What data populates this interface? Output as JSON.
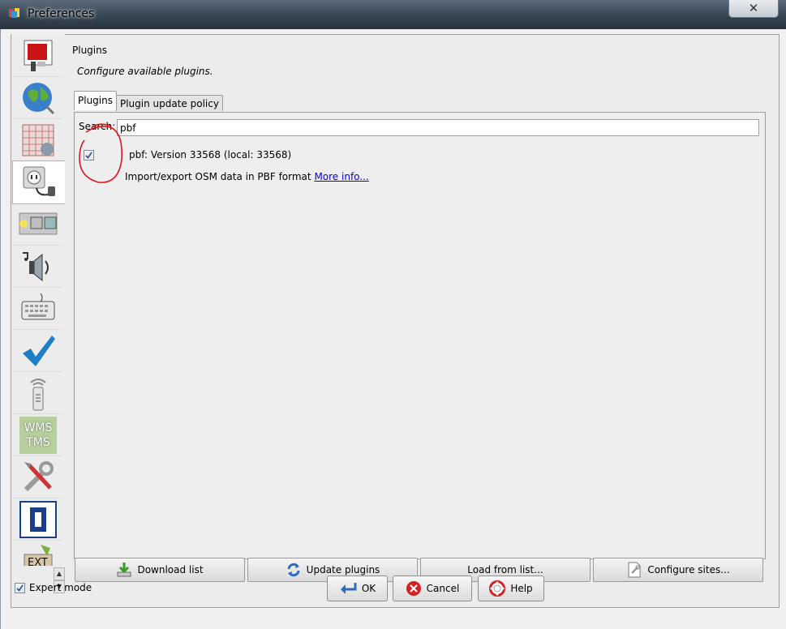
{
  "window": {
    "title": "Preferences",
    "close_glyph": "✕"
  },
  "sidebar": {
    "items": [
      {
        "icon": "display-preferences-icon"
      },
      {
        "icon": "globe-connection-icon"
      },
      {
        "icon": "map-projection-icon"
      },
      {
        "icon": "plugin-plug-icon",
        "active": true
      },
      {
        "icon": "toolbar-icon"
      },
      {
        "icon": "audio-speaker-icon"
      },
      {
        "icon": "keyboard-icon"
      },
      {
        "icon": "validator-checkmark-icon"
      },
      {
        "icon": "remote-control-icon"
      },
      {
        "icon": "wms-tms-icon",
        "label_top": "WMS",
        "label_bottom": "TMS"
      },
      {
        "icon": "advanced-tools-icon"
      },
      {
        "icon": "map-paint-style-icon"
      },
      {
        "icon": "ext-icon",
        "label": "EXT"
      }
    ]
  },
  "main": {
    "heading": "Plugins",
    "subheading": "Configure available plugins.",
    "tabs": [
      {
        "label": "Plugins",
        "active": true
      },
      {
        "label": "Plugin update policy",
        "active": false
      }
    ],
    "search": {
      "label": "Search:",
      "value": "pbf"
    },
    "plugin": {
      "checked": true,
      "name": "pbf: Version 33568 (local: 33568)",
      "description": "Import/export OSM data in PBF format",
      "link": "More info..."
    },
    "buttons": {
      "download": "Download list",
      "update": "Update plugins",
      "load": "Load from list...",
      "configure": "Configure sites..."
    }
  },
  "footer": {
    "expert_mode_label": "Expert mode",
    "expert_mode_checked": true,
    "ok": "OK",
    "cancel": "Cancel",
    "help": "Help"
  },
  "colors": {
    "annotation": "#e0141e",
    "link": "#0000ee"
  }
}
